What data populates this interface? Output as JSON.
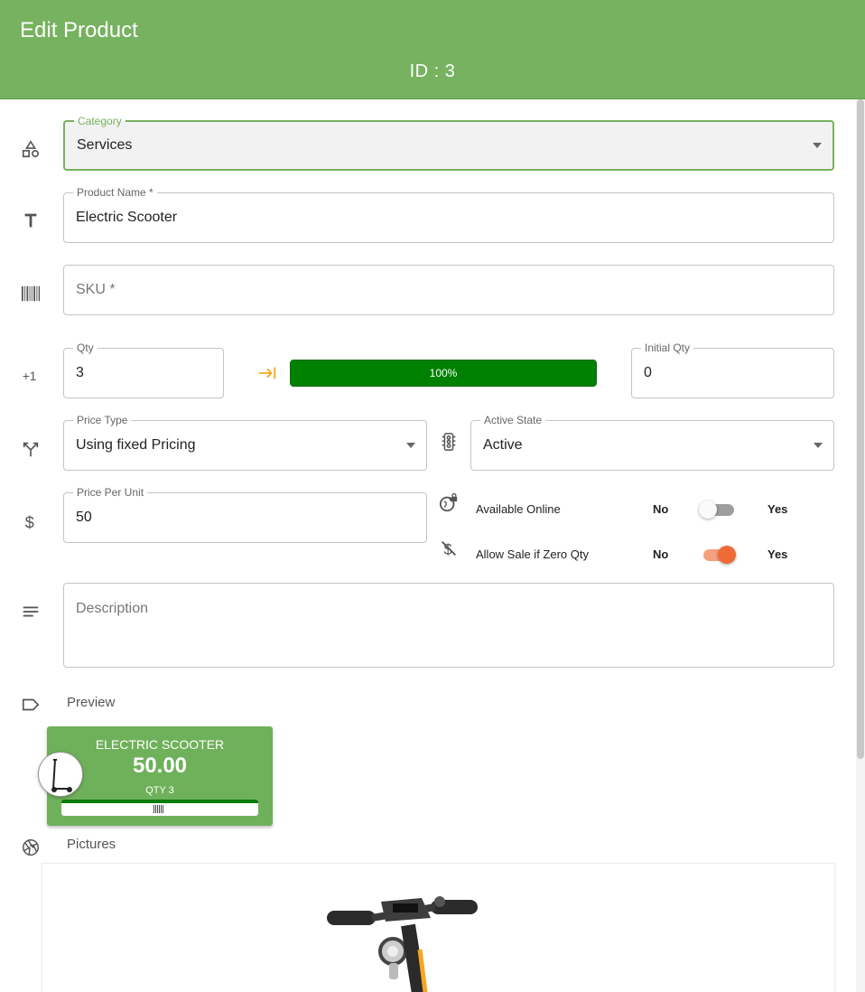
{
  "header": {
    "title": "Edit Product",
    "id_label": "ID : 3"
  },
  "form": {
    "category": {
      "label": "Category",
      "value": "Services"
    },
    "product_name": {
      "label": "Product Name *",
      "value": "Electric Scooter"
    },
    "sku": {
      "placeholder": "SKU *"
    },
    "qty": {
      "label": "Qty",
      "value": "3"
    },
    "stock_progress": {
      "percent": 100,
      "text": "100%"
    },
    "initial_qty": {
      "label": "Initial Qty",
      "value": "0"
    },
    "price_type": {
      "label": "Price Type",
      "value": "Using fixed Pricing"
    },
    "active_state": {
      "label": "Active State",
      "value": "Active"
    },
    "price_per_unit": {
      "label": "Price Per Unit",
      "value": "50"
    },
    "available_online": {
      "label": "Available Online",
      "no": "No",
      "yes": "Yes",
      "enabled": false
    },
    "allow_sale_zero": {
      "label": "Allow Sale if Zero Qty",
      "no": "No",
      "yes": "Yes",
      "enabled": true
    },
    "description": {
      "placeholder": "Description"
    }
  },
  "preview": {
    "section_label": "Preview",
    "card": {
      "name": "ELECTRIC SCOOTER",
      "price": "50.00",
      "qty": "QTY 3"
    }
  },
  "pictures": {
    "section_label": "Pictures"
  },
  "icons": {
    "category": "shapes-icon",
    "name": "text-icon",
    "sku": "barcode-icon",
    "qty": "plus-one-icon",
    "progress": "arrow-to-end-icon",
    "price_type": "merge-arrows-icon",
    "active_state": "traffic-light-icon",
    "price": "dollar-icon",
    "online": "globe-lock-icon",
    "zero_qty": "money-off-icon",
    "description": "notes-icon",
    "preview": "label-icon",
    "pictures": "camera-shutter-icon"
  },
  "colors": {
    "header": "#76b25f",
    "progress": "#008000",
    "toggle_on": "#ee6a36",
    "accent_arrow": "#f5a623"
  }
}
